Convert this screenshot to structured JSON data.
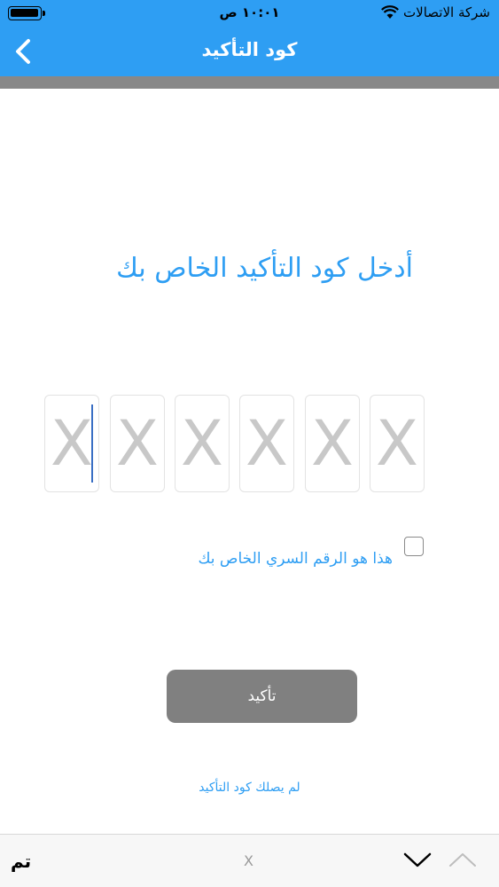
{
  "status_bar": {
    "carrier": "شركة الاتصالات",
    "time": "١٠:٠١ ص"
  },
  "nav": {
    "title": "كود التأكيد",
    "back_icon": "chevron-left-icon"
  },
  "main": {
    "heading": "أدخل كود التأكيد الخاص بك",
    "code_placeholders": [
      "X",
      "X",
      "X",
      "X",
      "X",
      "X"
    ],
    "checkbox_label": "هذا هو الرقم السري الخاص بك",
    "confirm_label": "تأكيد",
    "resend_label": "لم يصلك كود التأكيد"
  },
  "keyboard_toolbar": {
    "done_label": "تم",
    "placeholder": "X"
  },
  "colors": {
    "accent": "#2e9ef3",
    "button": "#808080"
  }
}
